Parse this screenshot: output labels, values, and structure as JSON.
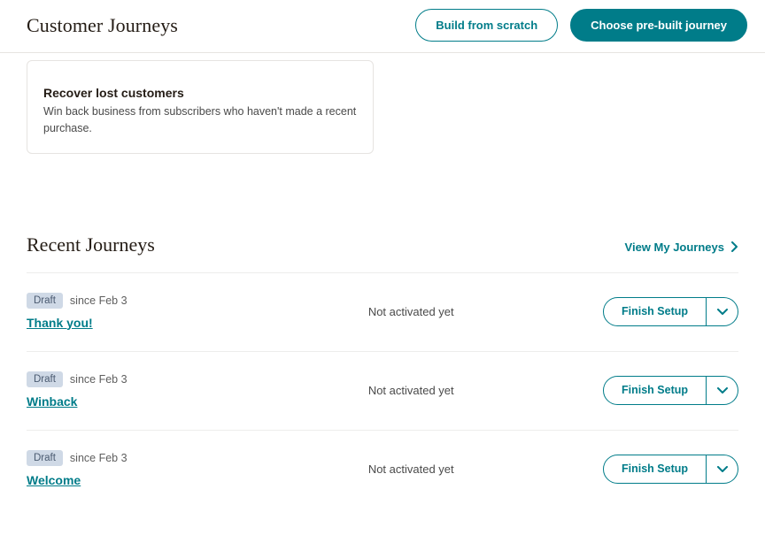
{
  "header": {
    "title": "Customer Journeys",
    "buildLabel": "Build from scratch",
    "chooseLabel": "Choose pre-built journey"
  },
  "card": {
    "title": "Recover lost customers",
    "desc": "Win back business from subscribers who haven't made a recent purchase."
  },
  "section": {
    "title": "Recent Journeys",
    "viewLink": "View My Journeys"
  },
  "journeys": [
    {
      "badge": "Draft",
      "since": "since Feb 3",
      "name": "Thank you!",
      "status": "Not activated yet",
      "action": "Finish Setup"
    },
    {
      "badge": "Draft",
      "since": "since Feb 3",
      "name": "Winback",
      "status": "Not activated yet",
      "action": "Finish Setup"
    },
    {
      "badge": "Draft",
      "since": "since Feb 3",
      "name": "Welcome",
      "status": "Not activated yet",
      "action": "Finish Setup"
    }
  ]
}
